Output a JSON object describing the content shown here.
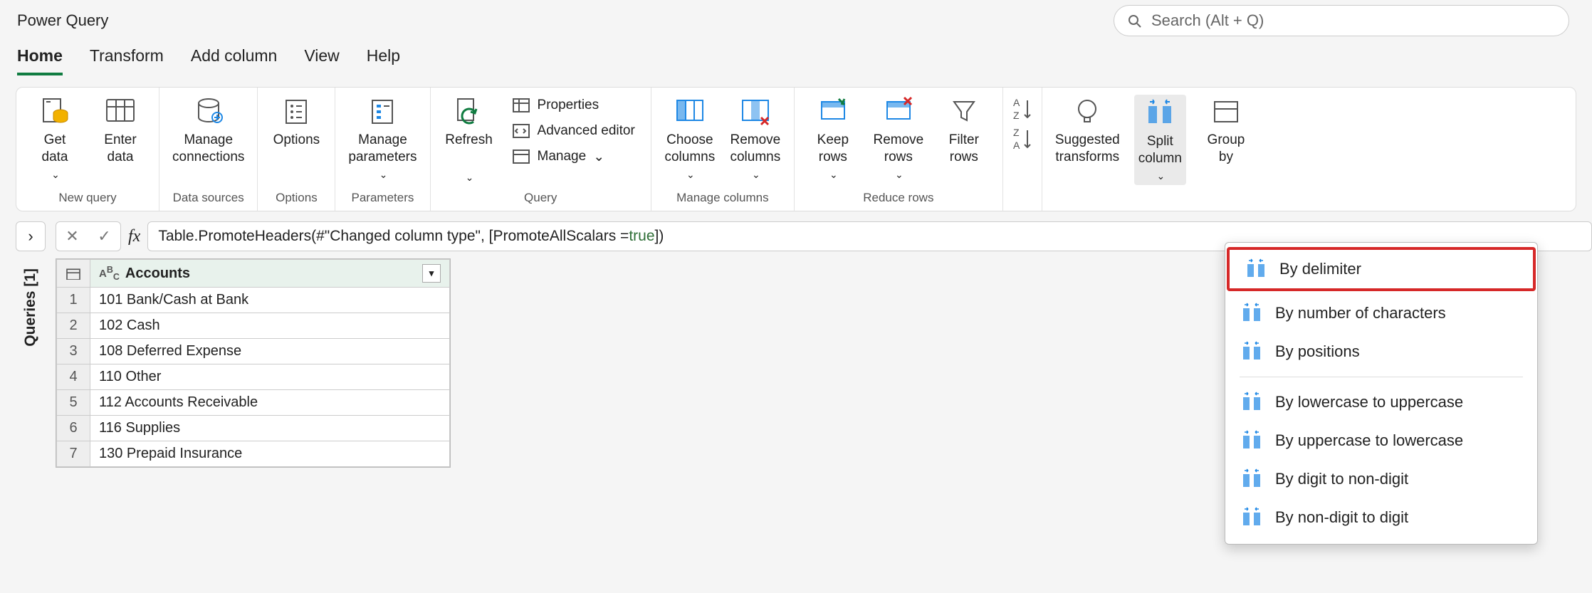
{
  "app_title": "Power Query",
  "search_placeholder": "Search (Alt + Q)",
  "menu_tabs": [
    "Home",
    "Transform",
    "Add column",
    "View",
    "Help"
  ],
  "active_tab": "Home",
  "ribbon": {
    "new_query": {
      "label": "New query",
      "get_data": "Get\ndata",
      "enter_data": "Enter\ndata"
    },
    "data_sources": {
      "label": "Data sources",
      "manage_connections": "Manage\nconnections"
    },
    "options": {
      "label": "Options",
      "options_btn": "Options"
    },
    "parameters": {
      "label": "Parameters",
      "manage_parameters": "Manage\nparameters"
    },
    "query": {
      "label": "Query",
      "refresh": "Refresh",
      "properties": "Properties",
      "advanced_editor": "Advanced editor",
      "manage": "Manage"
    },
    "manage_columns": {
      "label": "Manage columns",
      "choose_columns": "Choose\ncolumns",
      "remove_columns": "Remove\ncolumns"
    },
    "reduce_rows": {
      "label": "Reduce rows",
      "keep_rows": "Keep\nrows",
      "remove_rows": "Remove\nrows",
      "filter_rows": "Filter\nrows"
    },
    "sort": {
      "label": ""
    },
    "transform": {
      "suggested": "Suggested\ntransforms",
      "split_column": "Split\ncolumn",
      "group_by": "Group\nby"
    }
  },
  "queries_panel_label": "Queries [1]",
  "formula": {
    "prefix": "Table.PromoteHeaders(#\"Changed column type\", [PromoteAllScalars = ",
    "true_kw": "true",
    "suffix": "])"
  },
  "grid": {
    "column_header": "Accounts",
    "rows": [
      "101 Bank/Cash at Bank",
      "102 Cash",
      "108 Deferred Expense",
      "110 Other",
      "112 Accounts Receivable",
      "116 Supplies",
      "130 Prepaid Insurance"
    ]
  },
  "split_menu": {
    "by_delimiter": "By delimiter",
    "by_num_chars": "By number of characters",
    "by_positions": "By positions",
    "lower_to_upper": "By lowercase to uppercase",
    "upper_to_lower": "By uppercase to lowercase",
    "digit_to_non": "By digit to non-digit",
    "non_to_digit": "By non-digit to digit"
  }
}
